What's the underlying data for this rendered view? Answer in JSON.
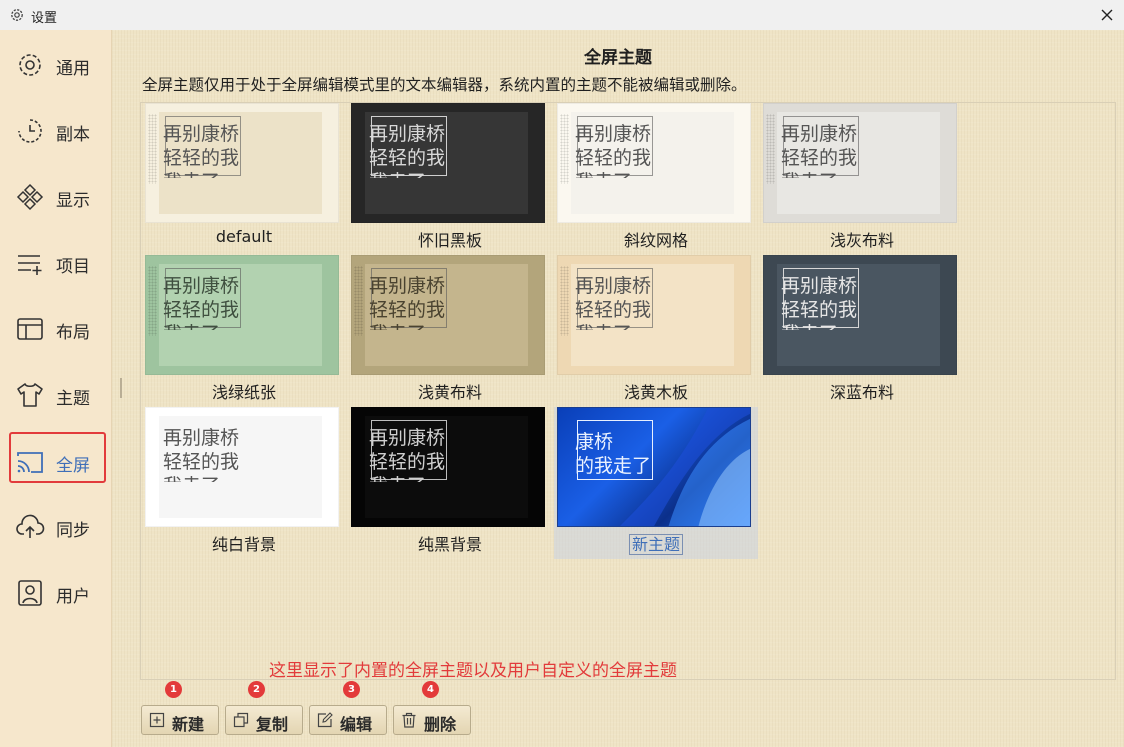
{
  "window": {
    "title": "设置"
  },
  "sidebar": {
    "items": [
      {
        "label": "通用",
        "icon": "gear-icon"
      },
      {
        "label": "副本",
        "icon": "clock-history-icon"
      },
      {
        "label": "显示",
        "icon": "diamond-grid-icon"
      },
      {
        "label": "项目",
        "icon": "list-add-icon"
      },
      {
        "label": "布局",
        "icon": "layout-icon"
      },
      {
        "label": "主题",
        "icon": "tshirt-icon"
      },
      {
        "label": "全屏",
        "icon": "cast-screen-icon",
        "active": true
      },
      {
        "label": "同步",
        "icon": "cloud-upload-icon"
      },
      {
        "label": "用户",
        "icon": "user-icon"
      }
    ]
  },
  "main": {
    "title": "全屏主题",
    "description": "全屏主题仅用于处于全屏编辑模式里的文本编辑器，系统内置的主题不能被编辑或删除。",
    "preview_text": {
      "line1": "再别康桥",
      "line2": "轻轻的我",
      "line3": "我走了"
    },
    "custom_preview_text": {
      "line1": "康桥",
      "line2": "的我走了"
    },
    "themes": [
      {
        "name": "default"
      },
      {
        "name": "怀旧黑板"
      },
      {
        "name": "斜纹网格"
      },
      {
        "name": "浅灰布料"
      },
      {
        "name": "浅绿纸张"
      },
      {
        "name": "浅黄布料"
      },
      {
        "name": "浅黄木板"
      },
      {
        "name": "深蓝布料"
      },
      {
        "name": "纯白背景"
      },
      {
        "name": "纯黑背景"
      },
      {
        "name": "新主题",
        "selected": true
      }
    ],
    "annotation": "这里显示了内置的全屏主题以及用户自定义的全屏主题"
  },
  "toolbar": {
    "new_label": "新建",
    "copy_label": "复制",
    "edit_label": "编辑",
    "delete_label": "删除",
    "badges": [
      "1",
      "2",
      "3",
      "4"
    ]
  },
  "colors": {
    "sidebar_bg": "#f6e7cc",
    "main_bg": "#efe4c6",
    "accent_blue": "#3f6fb8",
    "annotation_red": "#e23b3b"
  }
}
